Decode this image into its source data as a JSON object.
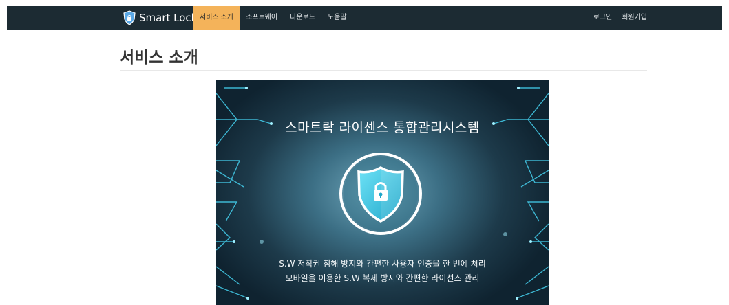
{
  "brand": {
    "name": "Smart Lock",
    "icon": "shield-icon"
  },
  "nav": {
    "left": [
      {
        "label": "서비스 소개",
        "active": true
      },
      {
        "label": "소프트웨어",
        "active": false
      },
      {
        "label": "다운로드",
        "active": false
      },
      {
        "label": "도움말",
        "active": false
      }
    ],
    "right": [
      {
        "label": "로그인"
      },
      {
        "label": "회원가입"
      }
    ]
  },
  "page": {
    "title": "서비스 소개"
  },
  "hero": {
    "title": "스마트락 라이센스  통합관리시스템",
    "icon": "shield-lock-icon",
    "line1": "S.W 저작권 침해 방지와 간편한 사용자 인증을 한 번에 처리",
    "line2": "모바일을 이용한 S.W 복제 방지와 간편한 라이선스 관리"
  },
  "colors": {
    "navbar_bg": "#1c2b33",
    "active_tab": "#f4b35a",
    "accent_cyan": "#4fd6f0"
  }
}
